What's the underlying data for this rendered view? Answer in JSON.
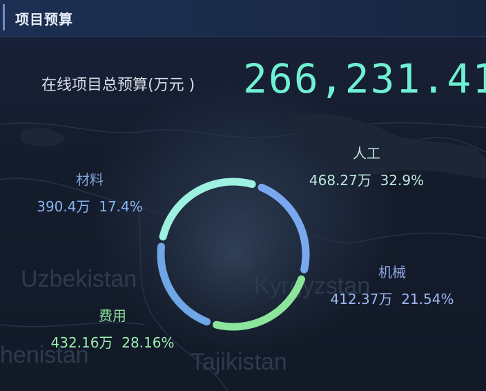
{
  "header": {
    "title": "项目预算"
  },
  "total": {
    "label": "在线项目总预算(万元 )",
    "value": "266,231.41"
  },
  "map_labels": [
    "Uzbekistan",
    "Kyrgyzstan",
    "Tajikistan",
    "henistan"
  ],
  "chart_data": {
    "type": "pie",
    "style": "donut",
    "title": "",
    "series": [
      {
        "name": "人工",
        "value_text": "468.27万",
        "percent_text": "32.9%",
        "value": 468.27,
        "percent": 32.9,
        "color": "#9ef0e0"
      },
      {
        "name": "机械",
        "value_text": "412.37万",
        "percent_text": "21.54%",
        "value": 412.37,
        "percent": 21.54,
        "color": "#7aa8ee"
      },
      {
        "name": "费用",
        "value_text": "432.16万",
        "percent_text": "28.16%",
        "value": 432.16,
        "percent": 28.16,
        "color": "#8be59a"
      },
      {
        "name": "材料",
        "value_text": "390.4万",
        "percent_text": "17.4%",
        "value": 390.4,
        "percent": 17.4,
        "color": "#6fa6e6"
      }
    ]
  },
  "colors": {
    "accent": "#6ff0d2",
    "header_bg": "#1c2f52",
    "background": "#141c2c"
  }
}
